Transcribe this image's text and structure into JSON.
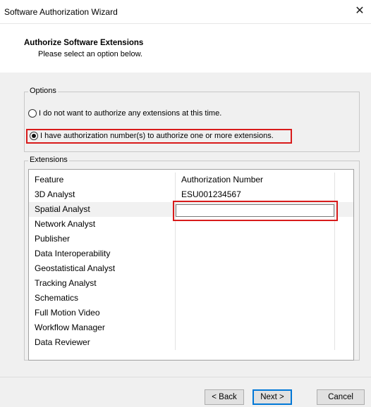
{
  "window": {
    "title": "Software Authorization Wizard",
    "close_glyph": "✕"
  },
  "header": {
    "title": "Authorize Software Extensions",
    "subtitle": "Please select an option below."
  },
  "options": {
    "label": "Options",
    "radios": [
      {
        "label": "I do not want to authorize any extensions at this time.",
        "checked": false
      },
      {
        "label": "I have authorization number(s) to authorize one or more extensions.",
        "checked": true
      }
    ]
  },
  "extensions": {
    "label": "Extensions",
    "columns": [
      "Feature",
      "Authorization Number"
    ],
    "rows": [
      {
        "feature": "3D Analyst",
        "auth": "ESU001234567"
      },
      {
        "feature": "Spatial Analyst",
        "auth": ""
      },
      {
        "feature": "Network Analyst",
        "auth": ""
      },
      {
        "feature": "Publisher",
        "auth": ""
      },
      {
        "feature": "Data Interoperability",
        "auth": ""
      },
      {
        "feature": "Geostatistical Analyst",
        "auth": ""
      },
      {
        "feature": "Tracking Analyst",
        "auth": ""
      },
      {
        "feature": "Schematics",
        "auth": ""
      },
      {
        "feature": "Full Motion Video",
        "auth": ""
      },
      {
        "feature": "Workflow Manager",
        "auth": ""
      },
      {
        "feature": "Data Reviewer",
        "auth": ""
      }
    ]
  },
  "buttons": {
    "back": "< Back",
    "next": "Next >",
    "cancel": "Cancel"
  },
  "colors": {
    "highlight": "#d81b1b",
    "focus": "#0078d7"
  }
}
